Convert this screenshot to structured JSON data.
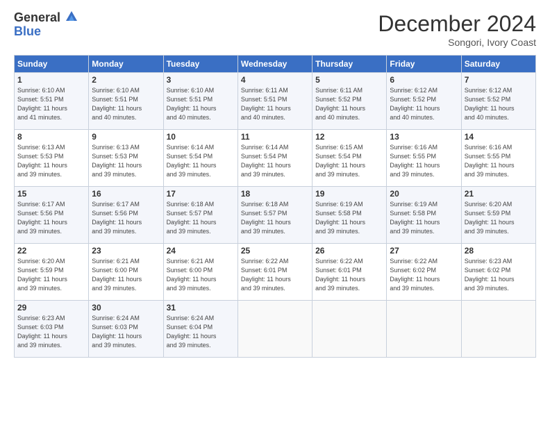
{
  "logo": {
    "general": "General",
    "blue": "Blue"
  },
  "title": "December 2024",
  "subtitle": "Songori, Ivory Coast",
  "days_of_week": [
    "Sunday",
    "Monday",
    "Tuesday",
    "Wednesday",
    "Thursday",
    "Friday",
    "Saturday"
  ],
  "weeks": [
    [
      {
        "day": "1",
        "info": "Sunrise: 6:10 AM\nSunset: 5:51 PM\nDaylight: 11 hours\nand 41 minutes."
      },
      {
        "day": "2",
        "info": "Sunrise: 6:10 AM\nSunset: 5:51 PM\nDaylight: 11 hours\nand 40 minutes."
      },
      {
        "day": "3",
        "info": "Sunrise: 6:10 AM\nSunset: 5:51 PM\nDaylight: 11 hours\nand 40 minutes."
      },
      {
        "day": "4",
        "info": "Sunrise: 6:11 AM\nSunset: 5:51 PM\nDaylight: 11 hours\nand 40 minutes."
      },
      {
        "day": "5",
        "info": "Sunrise: 6:11 AM\nSunset: 5:52 PM\nDaylight: 11 hours\nand 40 minutes."
      },
      {
        "day": "6",
        "info": "Sunrise: 6:12 AM\nSunset: 5:52 PM\nDaylight: 11 hours\nand 40 minutes."
      },
      {
        "day": "7",
        "info": "Sunrise: 6:12 AM\nSunset: 5:52 PM\nDaylight: 11 hours\nand 40 minutes."
      }
    ],
    [
      {
        "day": "8",
        "info": "Sunrise: 6:13 AM\nSunset: 5:53 PM\nDaylight: 11 hours\nand 39 minutes."
      },
      {
        "day": "9",
        "info": "Sunrise: 6:13 AM\nSunset: 5:53 PM\nDaylight: 11 hours\nand 39 minutes."
      },
      {
        "day": "10",
        "info": "Sunrise: 6:14 AM\nSunset: 5:54 PM\nDaylight: 11 hours\nand 39 minutes."
      },
      {
        "day": "11",
        "info": "Sunrise: 6:14 AM\nSunset: 5:54 PM\nDaylight: 11 hours\nand 39 minutes."
      },
      {
        "day": "12",
        "info": "Sunrise: 6:15 AM\nSunset: 5:54 PM\nDaylight: 11 hours\nand 39 minutes."
      },
      {
        "day": "13",
        "info": "Sunrise: 6:16 AM\nSunset: 5:55 PM\nDaylight: 11 hours\nand 39 minutes."
      },
      {
        "day": "14",
        "info": "Sunrise: 6:16 AM\nSunset: 5:55 PM\nDaylight: 11 hours\nand 39 minutes."
      }
    ],
    [
      {
        "day": "15",
        "info": "Sunrise: 6:17 AM\nSunset: 5:56 PM\nDaylight: 11 hours\nand 39 minutes."
      },
      {
        "day": "16",
        "info": "Sunrise: 6:17 AM\nSunset: 5:56 PM\nDaylight: 11 hours\nand 39 minutes."
      },
      {
        "day": "17",
        "info": "Sunrise: 6:18 AM\nSunset: 5:57 PM\nDaylight: 11 hours\nand 39 minutes."
      },
      {
        "day": "18",
        "info": "Sunrise: 6:18 AM\nSunset: 5:57 PM\nDaylight: 11 hours\nand 39 minutes."
      },
      {
        "day": "19",
        "info": "Sunrise: 6:19 AM\nSunset: 5:58 PM\nDaylight: 11 hours\nand 39 minutes."
      },
      {
        "day": "20",
        "info": "Sunrise: 6:19 AM\nSunset: 5:58 PM\nDaylight: 11 hours\nand 39 minutes."
      },
      {
        "day": "21",
        "info": "Sunrise: 6:20 AM\nSunset: 5:59 PM\nDaylight: 11 hours\nand 39 minutes."
      }
    ],
    [
      {
        "day": "22",
        "info": "Sunrise: 6:20 AM\nSunset: 5:59 PM\nDaylight: 11 hours\nand 39 minutes."
      },
      {
        "day": "23",
        "info": "Sunrise: 6:21 AM\nSunset: 6:00 PM\nDaylight: 11 hours\nand 39 minutes."
      },
      {
        "day": "24",
        "info": "Sunrise: 6:21 AM\nSunset: 6:00 PM\nDaylight: 11 hours\nand 39 minutes."
      },
      {
        "day": "25",
        "info": "Sunrise: 6:22 AM\nSunset: 6:01 PM\nDaylight: 11 hours\nand 39 minutes."
      },
      {
        "day": "26",
        "info": "Sunrise: 6:22 AM\nSunset: 6:01 PM\nDaylight: 11 hours\nand 39 minutes."
      },
      {
        "day": "27",
        "info": "Sunrise: 6:22 AM\nSunset: 6:02 PM\nDaylight: 11 hours\nand 39 minutes."
      },
      {
        "day": "28",
        "info": "Sunrise: 6:23 AM\nSunset: 6:02 PM\nDaylight: 11 hours\nand 39 minutes."
      }
    ],
    [
      {
        "day": "29",
        "info": "Sunrise: 6:23 AM\nSunset: 6:03 PM\nDaylight: 11 hours\nand 39 minutes."
      },
      {
        "day": "30",
        "info": "Sunrise: 6:24 AM\nSunset: 6:03 PM\nDaylight: 11 hours\nand 39 minutes."
      },
      {
        "day": "31",
        "info": "Sunrise: 6:24 AM\nSunset: 6:04 PM\nDaylight: 11 hours\nand 39 minutes."
      },
      null,
      null,
      null,
      null
    ]
  ]
}
